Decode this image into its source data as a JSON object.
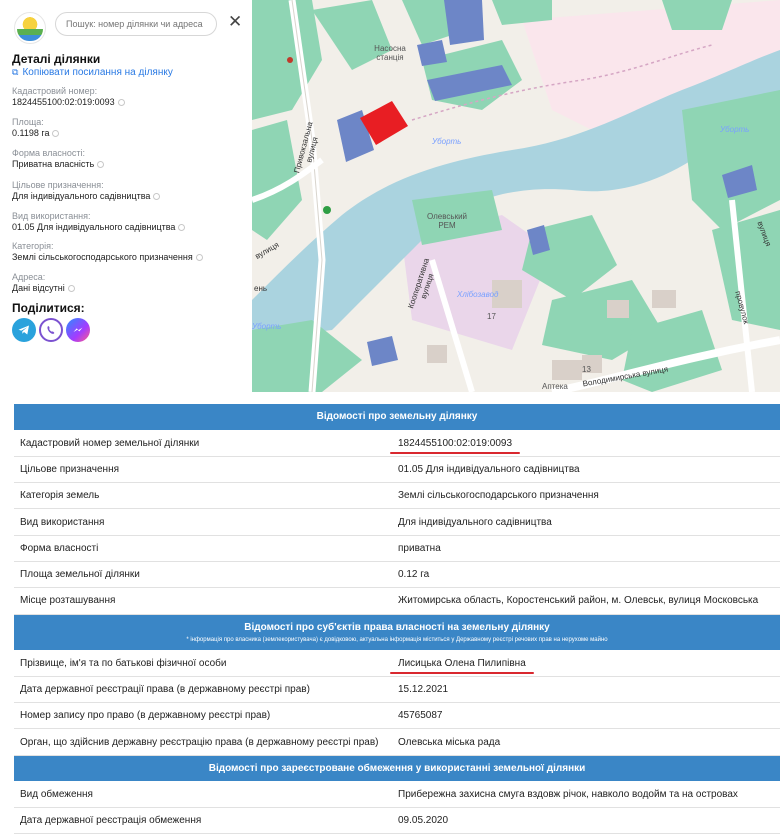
{
  "panel": {
    "search_placeholder": "Пошук: номер ділянки чи адреса",
    "close_symbol": "✕",
    "title": "Деталі ділянки",
    "copy_link": "Копіювати посилання на ділянку",
    "fields": [
      {
        "label": "Кадастровий номер:",
        "value": "1824455100:02:019:0093"
      },
      {
        "label": "Площа:",
        "value": "0.1198 га"
      },
      {
        "label": "Форма власності:",
        "value": "Приватна власність"
      },
      {
        "label": "Цільове призначення:",
        "value": "Для індивідуального садівництва"
      },
      {
        "label": "Вид використання:",
        "value": "01.05 Для індивідуального садівництва"
      },
      {
        "label": "Категорія:",
        "value": "Землі сільськогосподарського призначення"
      },
      {
        "label": "Адреса:",
        "value": "Дані відсутні"
      }
    ],
    "share_title": "Поділитися:",
    "share_icons": [
      "telegram-icon",
      "viber-icon",
      "messenger-icon"
    ]
  },
  "map": {
    "labels": {
      "station": "Насосна станція",
      "river1": "Уборть",
      "river2": "Уборть",
      "river3": "Уборть",
      "rem": "Олевський РЕМ",
      "khlibozavod": "Хлібозавод",
      "coop_street": "Кооперативна вулиця",
      "volodymyrska": "Володимирська вулиця",
      "pryvokzalna": "Привокзальна вулиця",
      "street_left": "вулиця",
      "lane": "ень",
      "num17": "17",
      "apteka": "Аптека",
      "num13": "13",
      "street_right": "провулок",
      "vul_right": "вулиця"
    },
    "colors": {
      "background": "#f2efe9",
      "water": "#aad3df",
      "wood": "#8fd5b4",
      "selected_parcel": "#e81e23",
      "blue_parcel": "#6d86c7"
    }
  },
  "table": {
    "section1": "Відомості про земельну ділянку",
    "rows1": [
      {
        "label": "Кадастровий номер земельної ділянки",
        "value": "1824455100:02:019:0093"
      },
      {
        "label": "Цільове призначення",
        "value": "01.05 Для індивідуального садівництва"
      },
      {
        "label": "Категорія земель",
        "value": "Землі сільськогосподарського призначення"
      },
      {
        "label": "Вид використання",
        "value": "Для індивідуального садівництва"
      },
      {
        "label": "Форма власності",
        "value": "приватна"
      },
      {
        "label": "Площа земельної ділянки",
        "value": "0.12 га"
      },
      {
        "label": "Місце розташування",
        "value": "Житомирська область, Коростенський район, м. Олевськ, вулиця Московська"
      }
    ],
    "section2": "Відомості про суб'єктів права власності на земельну ділянку",
    "section2_note": "* інформація про власника (землекористувача) є довідковою, актуальна інформація міститься у Державному реєстрі речових прав на нерухоме майно",
    "rows2": [
      {
        "label": "Прізвище, ім'я та по батькові фізичної особи",
        "value": "Лисицька Олена Пилипівна"
      },
      {
        "label": "Дата державної реєстрації права (в державному реєстрі прав)",
        "value": "15.12.2021"
      },
      {
        "label": "Номер запису про право (в державному реєстрі прав)",
        "value": "45765087"
      },
      {
        "label": "Орган, що здійснив державну реєстрацію права (в державному реєстрі прав)",
        "value": "Олевська міська рада"
      }
    ],
    "section3": "Відомості про зареєстроване обмеження у використанні земельної ділянки",
    "rows3": [
      {
        "label": "Вид обмеження",
        "value": "Прибережна захисна смуга вздовж річок, навколо водойм та на островах"
      },
      {
        "label": "Дата державної реєстрація обмеження",
        "value": "09.05.2020"
      }
    ]
  }
}
